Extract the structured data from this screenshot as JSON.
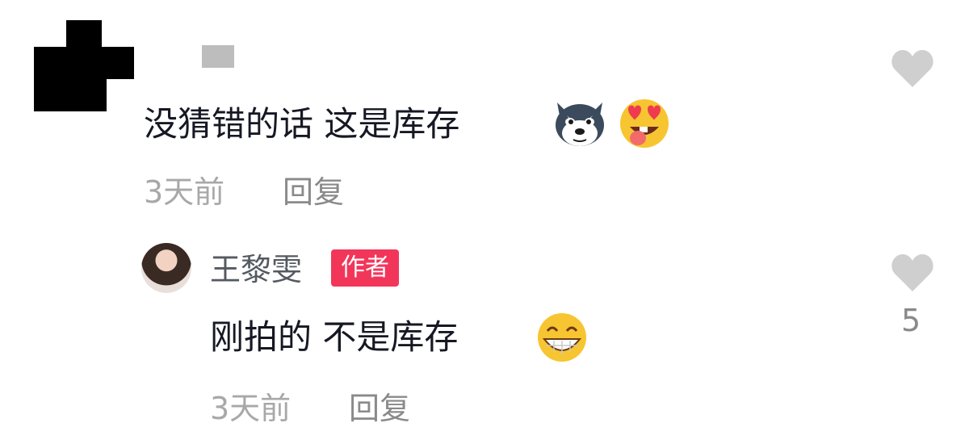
{
  "comment": {
    "text": "没猜错的话 这是库存",
    "time": "3天前",
    "reply_label": "回复",
    "emojis": [
      "husky-dog-emoji",
      "heart-eyes-tongue-emoji"
    ]
  },
  "reply": {
    "username": "王黎雯",
    "author_badge": "作者",
    "text": "刚拍的 不是库存",
    "time": "3天前",
    "reply_label": "回复",
    "like_count": "5",
    "emojis": [
      "grinning-teeth-emoji"
    ]
  },
  "colors": {
    "heart": "#cfcfcf",
    "badge": "#f2365a",
    "text": "#161823",
    "meta": "#a8a8a8"
  }
}
